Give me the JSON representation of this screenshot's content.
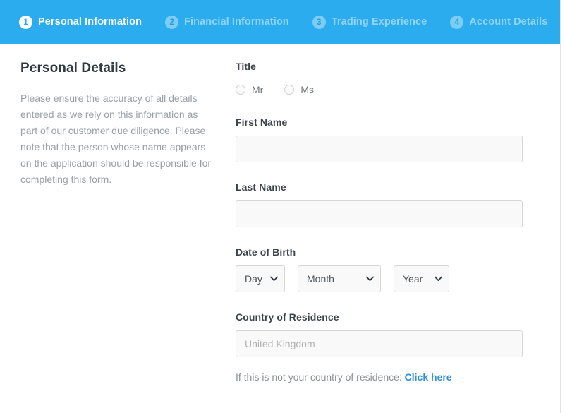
{
  "stepper": {
    "active_color": "#2bacee",
    "steps": [
      {
        "number": "1",
        "label": "Personal Information",
        "state": "active"
      },
      {
        "number": "2",
        "label": "Financial Information",
        "state": "inactive"
      },
      {
        "number": "3",
        "label": "Trading Experience",
        "state": "inactive"
      },
      {
        "number": "4",
        "label": "Account Details",
        "state": "inactive"
      }
    ]
  },
  "panel": {
    "title": "Personal Details",
    "description": "Please ensure the accuracy of all details entered as we rely on this information as part of our customer due diligence. Please note that the person whose name appears on the application should be responsible for completing this form."
  },
  "form": {
    "title": {
      "label": "Title",
      "options": [
        {
          "label": "Mr",
          "selected": false
        },
        {
          "label": "Ms",
          "selected": false
        }
      ]
    },
    "first_name": {
      "label": "First Name",
      "value": "",
      "placeholder": ""
    },
    "last_name": {
      "label": "Last Name",
      "value": "",
      "placeholder": ""
    },
    "date_of_birth": {
      "label": "Date of Birth",
      "day": {
        "selected": "Day"
      },
      "month": {
        "selected": "Month"
      },
      "year": {
        "selected": "Year"
      }
    },
    "country": {
      "label": "Country of Residence",
      "value": "",
      "placeholder": "United Kingdom"
    },
    "country_helper": {
      "text": "If this is not your country of residence: ",
      "link_label": "Click here",
      "link_color": "#2f8fd8"
    }
  }
}
